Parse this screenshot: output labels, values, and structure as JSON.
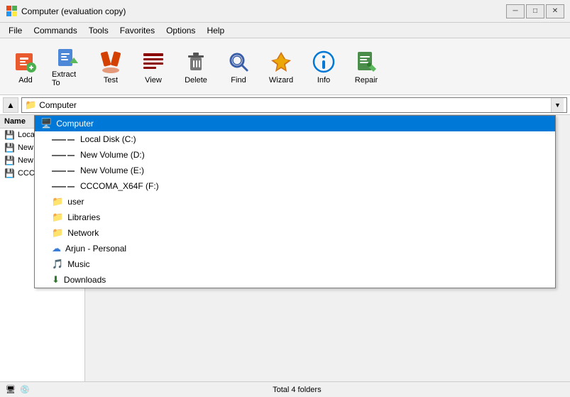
{
  "titleBar": {
    "title": "Computer (evaluation copy)",
    "minBtn": "─",
    "maxBtn": "□",
    "closeBtn": "✕"
  },
  "menuBar": {
    "items": [
      "File",
      "Commands",
      "Tools",
      "Favorites",
      "Options",
      "Help"
    ]
  },
  "toolbar": {
    "buttons": [
      {
        "id": "add",
        "label": "Add",
        "icon": "add"
      },
      {
        "id": "extract",
        "label": "Extract To",
        "icon": "extract"
      },
      {
        "id": "test",
        "label": "Test",
        "icon": "test"
      },
      {
        "id": "view",
        "label": "View",
        "icon": "view"
      },
      {
        "id": "delete",
        "label": "Delete",
        "icon": "delete"
      },
      {
        "id": "find",
        "label": "Find",
        "icon": "find"
      },
      {
        "id": "wizard",
        "label": "Wizard",
        "icon": "wizard"
      },
      {
        "id": "info",
        "label": "Info",
        "icon": "info"
      },
      {
        "id": "repair",
        "label": "Repair",
        "icon": "repair"
      }
    ]
  },
  "addressBar": {
    "upLabel": "▲",
    "dropdownLabel": "▼",
    "currentPath": "Computer",
    "folderIcon": "📁"
  },
  "sidebar": {
    "header": "Name",
    "items": [
      {
        "id": "local-disk",
        "label": "Local ...",
        "icon": "💾"
      },
      {
        "id": "new-vol-d",
        "label": "New V...",
        "icon": "💾"
      },
      {
        "id": "new-vol-e",
        "label": "New V...",
        "icon": "💾"
      },
      {
        "id": "cccoma",
        "label": "CCCO...",
        "icon": "💾"
      }
    ]
  },
  "dropdown": {
    "items": [
      {
        "id": "computer",
        "label": "Computer",
        "icon": "computer",
        "selected": true,
        "indent": 0
      },
      {
        "id": "local-disk-c",
        "label": "Local Disk (C:)",
        "icon": "drive",
        "selected": false,
        "indent": 1
      },
      {
        "id": "new-volume-d",
        "label": "New Volume (D:)",
        "icon": "drive",
        "selected": false,
        "indent": 1
      },
      {
        "id": "new-volume-e",
        "label": "New Volume (E:)",
        "icon": "drive",
        "selected": false,
        "indent": 1
      },
      {
        "id": "cccoma-f",
        "label": "CCCOMA_X64F (F:)",
        "icon": "drive",
        "selected": false,
        "indent": 1
      },
      {
        "id": "user",
        "label": "user",
        "icon": "folder",
        "selected": false,
        "indent": 1
      },
      {
        "id": "libraries",
        "label": "Libraries",
        "icon": "folder",
        "selected": false,
        "indent": 1
      },
      {
        "id": "network",
        "label": "Network",
        "icon": "network",
        "selected": false,
        "indent": 1
      },
      {
        "id": "arjun-personal",
        "label": "Arjun - Personal",
        "icon": "cloud",
        "selected": false,
        "indent": 1
      },
      {
        "id": "music",
        "label": "Music",
        "icon": "music",
        "selected": false,
        "indent": 1
      },
      {
        "id": "downloads",
        "label": "Downloads",
        "icon": "download",
        "selected": false,
        "indent": 1
      }
    ]
  },
  "statusBar": {
    "text": "Total 4 folders",
    "icons": [
      "pc",
      "disk"
    ]
  }
}
